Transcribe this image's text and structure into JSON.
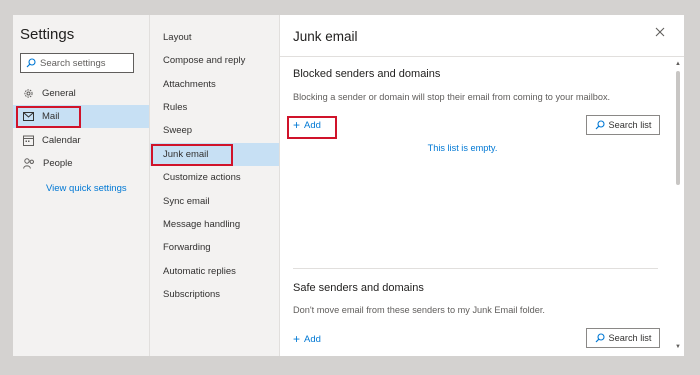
{
  "settings": {
    "title": "Settings",
    "search_placeholder": "Search settings",
    "categories": [
      {
        "label": "General",
        "icon": "gear-icon"
      },
      {
        "label": "Mail",
        "icon": "mail-icon"
      },
      {
        "label": "Calendar",
        "icon": "calendar-icon"
      },
      {
        "label": "People",
        "icon": "people-icon"
      }
    ],
    "quick_settings_link": "View quick settings"
  },
  "mail_menu": {
    "items": [
      "Layout",
      "Compose and reply",
      "Attachments",
      "Rules",
      "Sweep",
      "Junk email",
      "Customize actions",
      "Sync email",
      "Message handling",
      "Forwarding",
      "Automatic replies",
      "Subscriptions"
    ],
    "selected": "Junk email"
  },
  "panel": {
    "title": "Junk email",
    "blocked": {
      "title": "Blocked senders and domains",
      "description": "Blocking a sender or domain will stop their email from coming to your mailbox.",
      "add_label": "Add",
      "search_label": "Search list",
      "empty_message": "This list is empty."
    },
    "safe": {
      "title": "Safe senders and domains",
      "description": "Don't move email from these senders to my Junk Email folder.",
      "add_label": "Add",
      "search_label": "Search list"
    }
  },
  "colors": {
    "accent": "#0078d4",
    "selected_background": "#c7e0f4",
    "highlight_red": "#d0132a"
  }
}
